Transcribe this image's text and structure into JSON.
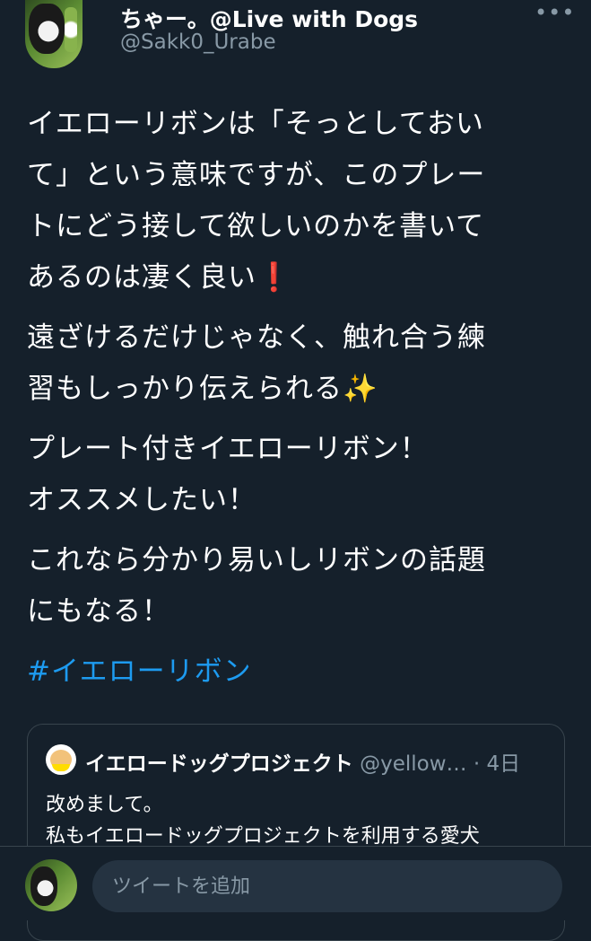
{
  "author": {
    "display_name": "ちゃー。@Live with Dogs",
    "handle": "@Sakk0_Urabe"
  },
  "tweet": {
    "paragraphs": [
      "イエローリボンは「そっとしておい\nて」という意味ですが、このプレー\nトにどう接して欲しいのかを書いて\nあるのは凄く良い",
      "遠ざけるだけじゃなく、触れ合う練\n習もしっかり伝えられる",
      "プレート付きイエローリボン！\nオススメしたい！",
      "これなら分かり易いしリボンの話題\nにもなる！"
    ],
    "emoji_exclamation": "❗",
    "emoji_sparkles": "✨",
    "hashtag": "#イエローリボン"
  },
  "quoted_tweet": {
    "name": "イエロードッグプロジェクト",
    "handle": "@yellow…",
    "time": "· 4日",
    "text": "改めまして。\n私もイエロードッグプロジェクトを利用する愛犬"
  },
  "reply": {
    "placeholder": "ツイートを追加"
  },
  "icons": {
    "more": "more-icon"
  },
  "colors": {
    "background": "#15202b",
    "link": "#1d9bf0",
    "secondary_text": "#8899a6",
    "input_bg": "#253341"
  }
}
